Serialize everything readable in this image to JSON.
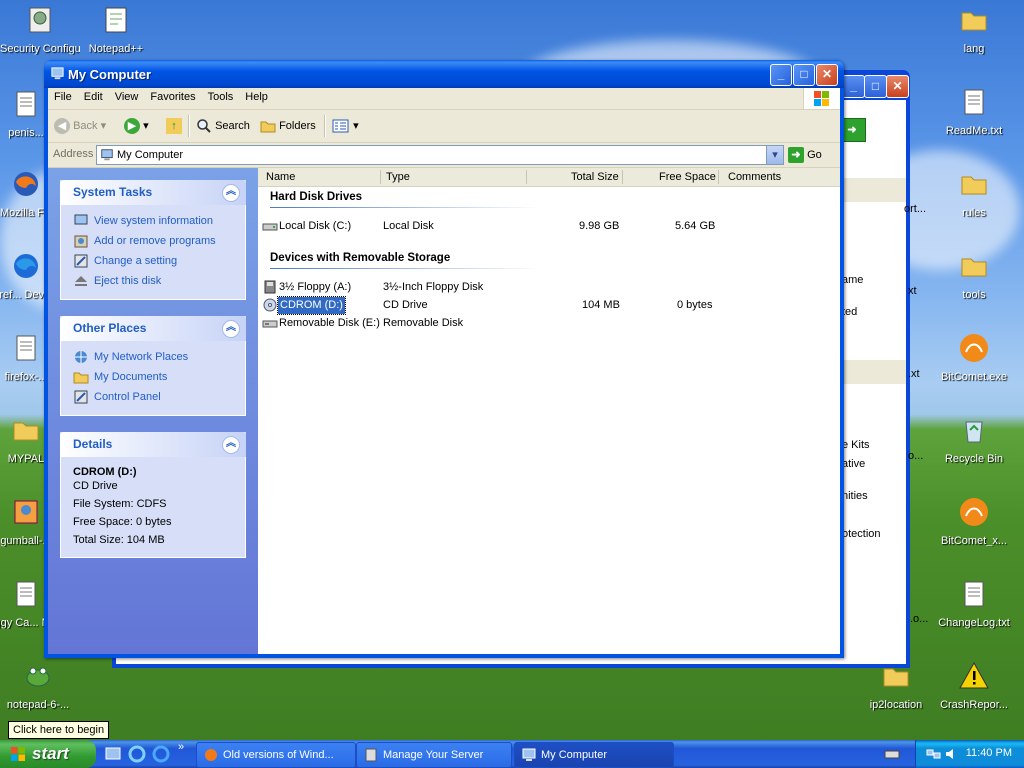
{
  "desktop": {
    "left_icons": [
      {
        "label": "Security Configurat...",
        "icon": "security-config-icon"
      },
      {
        "label": "Notepad++",
        "icon": "notepad-icon"
      },
      {
        "label": "penis...",
        "icon": "text-file-icon"
      },
      {
        "label": "Mozilla F...",
        "icon": "firefox-icon"
      },
      {
        "label": "Firef... Devel...",
        "icon": "firefox-icon"
      },
      {
        "label": "firefox-...",
        "icon": "text-file-icon"
      },
      {
        "label": "MYPAL",
        "icon": "folder-icon"
      },
      {
        "label": "gumball-...",
        "icon": "image-icon"
      },
      {
        "label": "Oggy Ca... Network",
        "icon": "text-file-icon"
      },
      {
        "label": "notepad-6-...",
        "icon": "frog-icon"
      }
    ],
    "right_icons": [
      {
        "label": "lang",
        "icon": "folder-icon"
      },
      {
        "label": "ReadMe.txt",
        "icon": "text-file-icon"
      },
      {
        "label": "rules",
        "icon": "folder-icon"
      },
      {
        "label": "tools",
        "icon": "folder-icon"
      },
      {
        "label": "BitComet.exe",
        "icon": "bitcomet-icon"
      },
      {
        "label": "Recycle Bin",
        "icon": "recycle-bin-icon"
      },
      {
        "label": "BitComet_x...",
        "icon": "bitcomet-icon"
      },
      {
        "label": "ChangeLog.txt",
        "icon": "text-file-icon"
      },
      {
        "label": "CrashRepor...",
        "icon": "warning-icon"
      },
      {
        "label": "ip2location",
        "icon": "folder-icon"
      }
    ],
    "bg_window_fragments": [
      "ort...",
      "ame",
      "xt",
      "ted",
      ".xt",
      "o...",
      "e Kits",
      "ative",
      "nities",
      "otection",
      ".o..."
    ]
  },
  "window": {
    "title": "My Computer",
    "menu": [
      "File",
      "Edit",
      "View",
      "Favorites",
      "Tools",
      "Help"
    ],
    "toolbar": {
      "back": "Back",
      "search": "Search",
      "folders": "Folders"
    },
    "address": {
      "label": "Address",
      "value": "My Computer",
      "go": "Go"
    },
    "tasks": {
      "system": {
        "title": "System Tasks",
        "links": [
          "View system information",
          "Add or remove programs",
          "Change a setting",
          "Eject this disk"
        ]
      },
      "places": {
        "title": "Other Places",
        "links": [
          "My Network Places",
          "My Documents",
          "Control Panel"
        ]
      },
      "details": {
        "title": "Details",
        "name": "CDROM (D:)",
        "type": "CD Drive",
        "fs": "File System: CDFS",
        "free": "Free Space: 0 bytes",
        "total": "Total Size: 104 MB"
      }
    },
    "columns": [
      "Name",
      "Type",
      "Total Size",
      "Free Space",
      "Comments"
    ],
    "groups": {
      "hdd": {
        "title": "Hard Disk Drives",
        "rows": [
          {
            "name": "Local Disk (C:)",
            "type": "Local Disk",
            "total": "9.98 GB",
            "free": "5.64 GB"
          }
        ]
      },
      "removable": {
        "title": "Devices with Removable Storage",
        "rows": [
          {
            "name": "3½ Floppy (A:)",
            "type": "3½-Inch Floppy Disk",
            "total": "",
            "free": ""
          },
          {
            "name": "CDROM (D:)",
            "type": "CD Drive",
            "total": "104 MB",
            "free": "0 bytes"
          },
          {
            "name": "Removable Disk (E:)",
            "type": "Removable Disk",
            "total": "",
            "free": ""
          }
        ]
      }
    }
  },
  "taskbar": {
    "start": "start",
    "tooltip": "Click here to begin",
    "tasks": [
      "Old versions of Wind...",
      "Manage Your Server",
      "My Computer"
    ],
    "clock": "11:40 PM"
  },
  "colors": {
    "xp_blue": "#0054e3",
    "task_link": "#215dc6",
    "selection": "#316ac5"
  }
}
